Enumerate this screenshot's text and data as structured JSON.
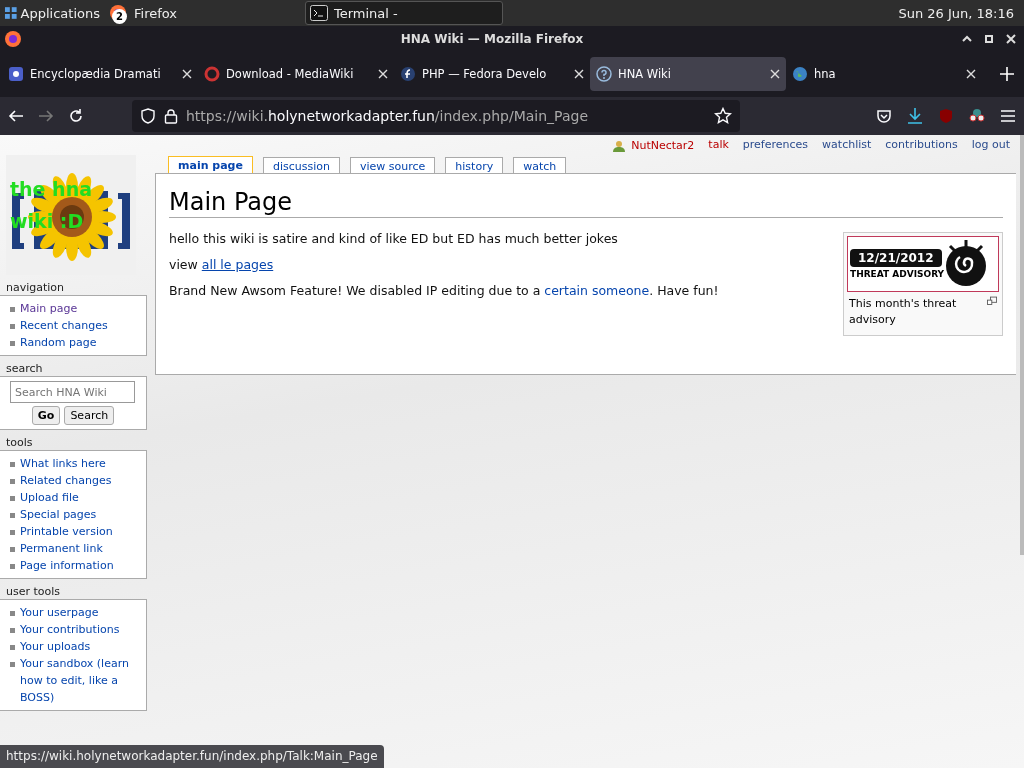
{
  "desktop_panel": {
    "menu": "Applications",
    "tasks": [
      {
        "label": "Firefox",
        "badge": "2",
        "selected": false
      },
      {
        "label": "Terminal -",
        "selected": true
      }
    ],
    "clock": "Sun 26 Jun, 18:16"
  },
  "window": {
    "title": "HNA Wiki — Mozilla Firefox"
  },
  "tabs": [
    {
      "label": "Encyclopædia Dramati",
      "selected": false
    },
    {
      "label": "Download - MediaWiki",
      "selected": false
    },
    {
      "label": "PHP — Fedora Develo",
      "selected": false
    },
    {
      "label": "HNA Wiki",
      "selected": true
    },
    {
      "label": "hna",
      "selected": false
    }
  ],
  "address": {
    "prefix": "https://wiki.",
    "domain": "holynetworkadapter.fun",
    "path": "/index.php/Main_Page"
  },
  "wiki": {
    "logo_text": [
      "the hna",
      "wiki :D"
    ],
    "personal_links": [
      {
        "label": "NutNectar2",
        "kind": "user"
      },
      {
        "label": "talk",
        "kind": "new"
      },
      {
        "label": "preferences",
        "kind": "link"
      },
      {
        "label": "watchlist",
        "kind": "link"
      },
      {
        "label": "contributions",
        "kind": "link"
      },
      {
        "label": "log out",
        "kind": "link"
      }
    ],
    "page_tabs": [
      {
        "label": "main page",
        "selected": true
      },
      {
        "label": "discussion",
        "selected": false
      },
      {
        "label": "view source",
        "selected": false
      },
      {
        "label": "history",
        "selected": false
      },
      {
        "label": "watch",
        "selected": false
      }
    ],
    "heading": "Main Page",
    "paragraphs": [
      [
        {
          "text": "hello this wiki is satire and kind of like ED but ED has much better jokes"
        }
      ],
      [
        {
          "text": "view "
        },
        {
          "text": "all le pages",
          "kind": "link",
          "underlined": true
        }
      ],
      [
        {
          "text": "Brand New Awsom Feature! We disabled IP editing due to a "
        },
        {
          "text": "certain someone",
          "kind": "link",
          "underlined": false
        },
        {
          "text": ". Have fun!"
        }
      ]
    ],
    "thumbnail": {
      "date": "12/21/2012",
      "title": "THREAT ADVISORY",
      "caption": "This month's threat advisory"
    },
    "portlets": [
      {
        "heading": "navigation",
        "kind": "links",
        "items": [
          {
            "label": "Main page",
            "visited": true
          },
          {
            "label": "Recent changes",
            "visited": false
          },
          {
            "label": "Random page",
            "visited": false
          }
        ]
      },
      {
        "heading": "search",
        "kind": "search",
        "placeholder": "Search HNA Wiki",
        "buttons": [
          "Go",
          "Search"
        ]
      },
      {
        "heading": "tools",
        "kind": "links",
        "items": [
          {
            "label": "What links here",
            "visited": false
          },
          {
            "label": "Related changes",
            "visited": false
          },
          {
            "label": "Upload file",
            "visited": false
          },
          {
            "label": "Special pages",
            "visited": false
          },
          {
            "label": "Printable version",
            "visited": false
          },
          {
            "label": "Permanent link",
            "visited": false
          },
          {
            "label": "Page information",
            "visited": false
          }
        ]
      },
      {
        "heading": "user tools",
        "kind": "links",
        "items": [
          {
            "label": "Your userpage",
            "visited": false
          },
          {
            "label": "Your contributions",
            "visited": false
          },
          {
            "label": "Your uploads",
            "visited": false
          },
          {
            "label": "Your sandbox (learn how to edit, like a BOSS)",
            "visited": false
          }
        ]
      }
    ]
  },
  "status_url": "https://wiki.holynetworkadapter.fun/index.php/Talk:Main_Page"
}
